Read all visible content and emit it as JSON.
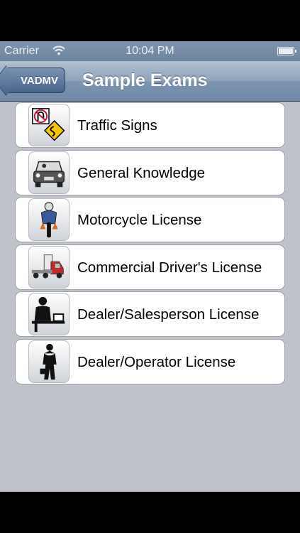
{
  "status_bar": {
    "carrier": "Carrier",
    "time": "10:04 PM"
  },
  "nav": {
    "back_label": "VADMV",
    "title": "Sample Exams"
  },
  "exams": [
    {
      "label": "Traffic Signs",
      "icon": "traffic-signs-icon"
    },
    {
      "label": "General Knowledge",
      "icon": "car-front-icon"
    },
    {
      "label": "Motorcycle License",
      "icon": "motorcycle-icon"
    },
    {
      "label": "Commercial Driver's License",
      "icon": "truck-icon"
    },
    {
      "label": "Dealer/Salesperson License",
      "icon": "salesperson-icon"
    },
    {
      "label": "Dealer/Operator License",
      "icon": "operator-icon"
    }
  ],
  "colors": {
    "nav_bar": "#7d94b0",
    "background": "#bfc3c9",
    "back_button": "#46648a"
  }
}
